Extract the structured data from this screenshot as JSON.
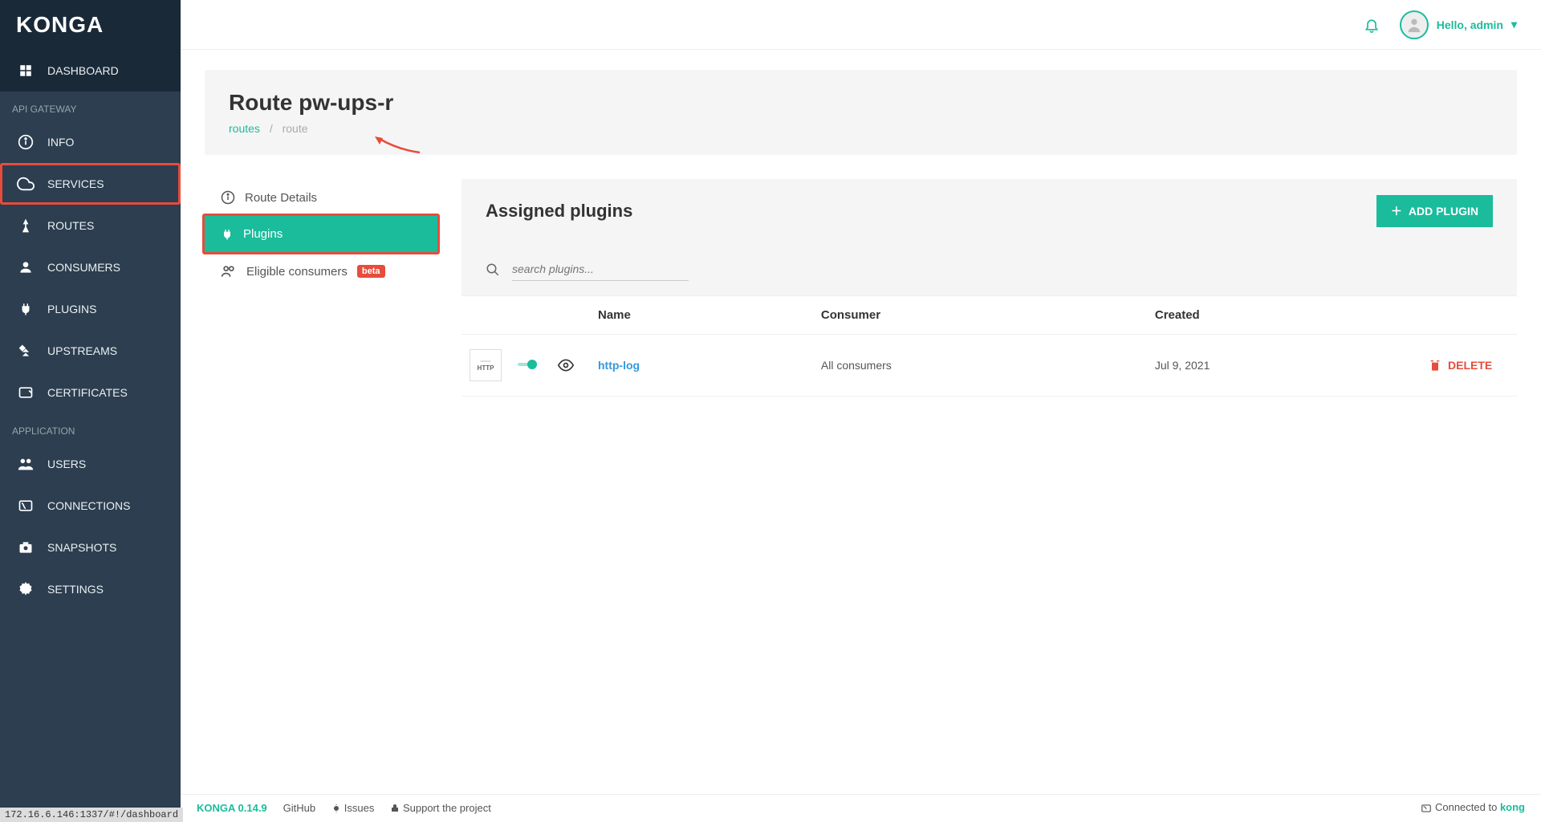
{
  "app": {
    "logo": "KONGA"
  },
  "topbar": {
    "greeting": "Hello, admin"
  },
  "sidebar": {
    "sections": {
      "api_gateway": "API GATEWAY",
      "application": "APPLICATION"
    },
    "items": {
      "dashboard": "DASHBOARD",
      "info": "INFO",
      "services": "SERVICES",
      "routes": "ROUTES",
      "consumers": "CONSUMERS",
      "plugins": "PLUGINS",
      "upstreams": "UPSTREAMS",
      "certificates": "CERTIFICATES",
      "users": "USERS",
      "connections": "CONNECTIONS",
      "snapshots": "SNAPSHOTS",
      "settings": "SETTINGS"
    }
  },
  "page": {
    "title": "Route pw-ups-r",
    "breadcrumb": {
      "root": "routes",
      "current": "route"
    }
  },
  "tabs": {
    "details": "Route Details",
    "plugins": "Plugins",
    "eligible": "Eligible consumers",
    "beta": "beta"
  },
  "panel": {
    "title": "Assigned plugins",
    "add_button": "ADD PLUGIN",
    "search_placeholder": "search plugins...",
    "columns": {
      "name": "Name",
      "consumer": "Consumer",
      "created": "Created"
    },
    "rows": [
      {
        "icon_label": "HTTP",
        "name": "http-log",
        "consumer": "All consumers",
        "created": "Jul 9, 2021",
        "delete": "DELETE"
      }
    ]
  },
  "footer": {
    "version": "KONGA 0.14.9",
    "github": "GitHub",
    "issues": "Issues",
    "support": "Support the project",
    "connected": "Connected to",
    "connected_to": "kong"
  },
  "statusbar": {
    "url": "172.16.6.146:1337/#!/dashboard"
  }
}
